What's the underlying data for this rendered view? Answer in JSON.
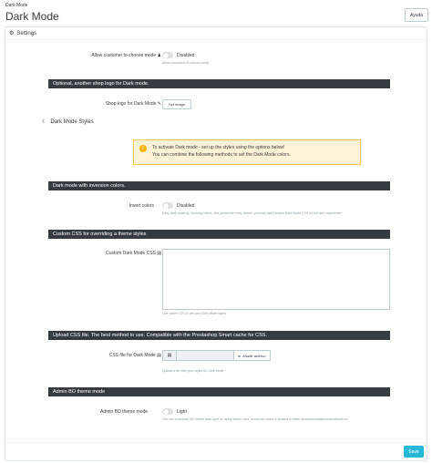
{
  "breadcrumb": "Dark Mode",
  "page_title": "Dark Mode",
  "help_button": "Ayuda",
  "panel_title": "Settings",
  "allow_choose": {
    "label": "Allow customer to choose mode",
    "state": "Disabled",
    "help": "Allow customers to choose mode"
  },
  "sections": {
    "logo": "Optional, another shop logo for Dark mode.",
    "inversion": "Dark mode with inversion colors.",
    "custom_css": "Custom CSS for overriding a theme styles",
    "upload_css": "Upload CSS file. The best method to use. Compatible with the Prestashop Smart cache for CSS.",
    "admin_bo": "Admin BO theme mode"
  },
  "shop_logo": {
    "label": "Shop logo for Dark Mode",
    "button": "Set image"
  },
  "dark_styles_title": "Dark Mode Styles",
  "alert": {
    "line1": "To activate Dark mode - set up the styles using the options below!",
    "line2": "You can combine the following methods to set the Dark Mode colors."
  },
  "invert": {
    "label": "Invert colors",
    "state": "Disabled",
    "help": "Easy dark mode by inverting colors. Not perfect for every theme, you may add Custom Dark Mode CSS for full user experience"
  },
  "custom_css": {
    "label": "Custom Dark Mode CSS",
    "help": "Use native CSS to set your Dark Mode styles"
  },
  "css_file": {
    "label": "CSS file for Dark Mode",
    "button": "Añadir archivo",
    "help": "Upload a file with your styles for Dark Mode"
  },
  "admin_theme": {
    "label": "Admin BO theme mode",
    "state": "Light",
    "help": "You can customize BO theme dark style by using admin_dark_mode.css which is located in folder /modules/dsdarkmode/views/css/"
  },
  "save_button": "Save",
  "colors": {
    "section_bar": "#363a41",
    "primary": "#25b9d7",
    "alert_bg": "#fff3d7",
    "alert_border": "#fcc85b"
  },
  "icons": [
    "gear-icon",
    "user-icon",
    "pencil-icon",
    "moon-icon",
    "warning-icon",
    "file-icon",
    "folder-icon"
  ]
}
